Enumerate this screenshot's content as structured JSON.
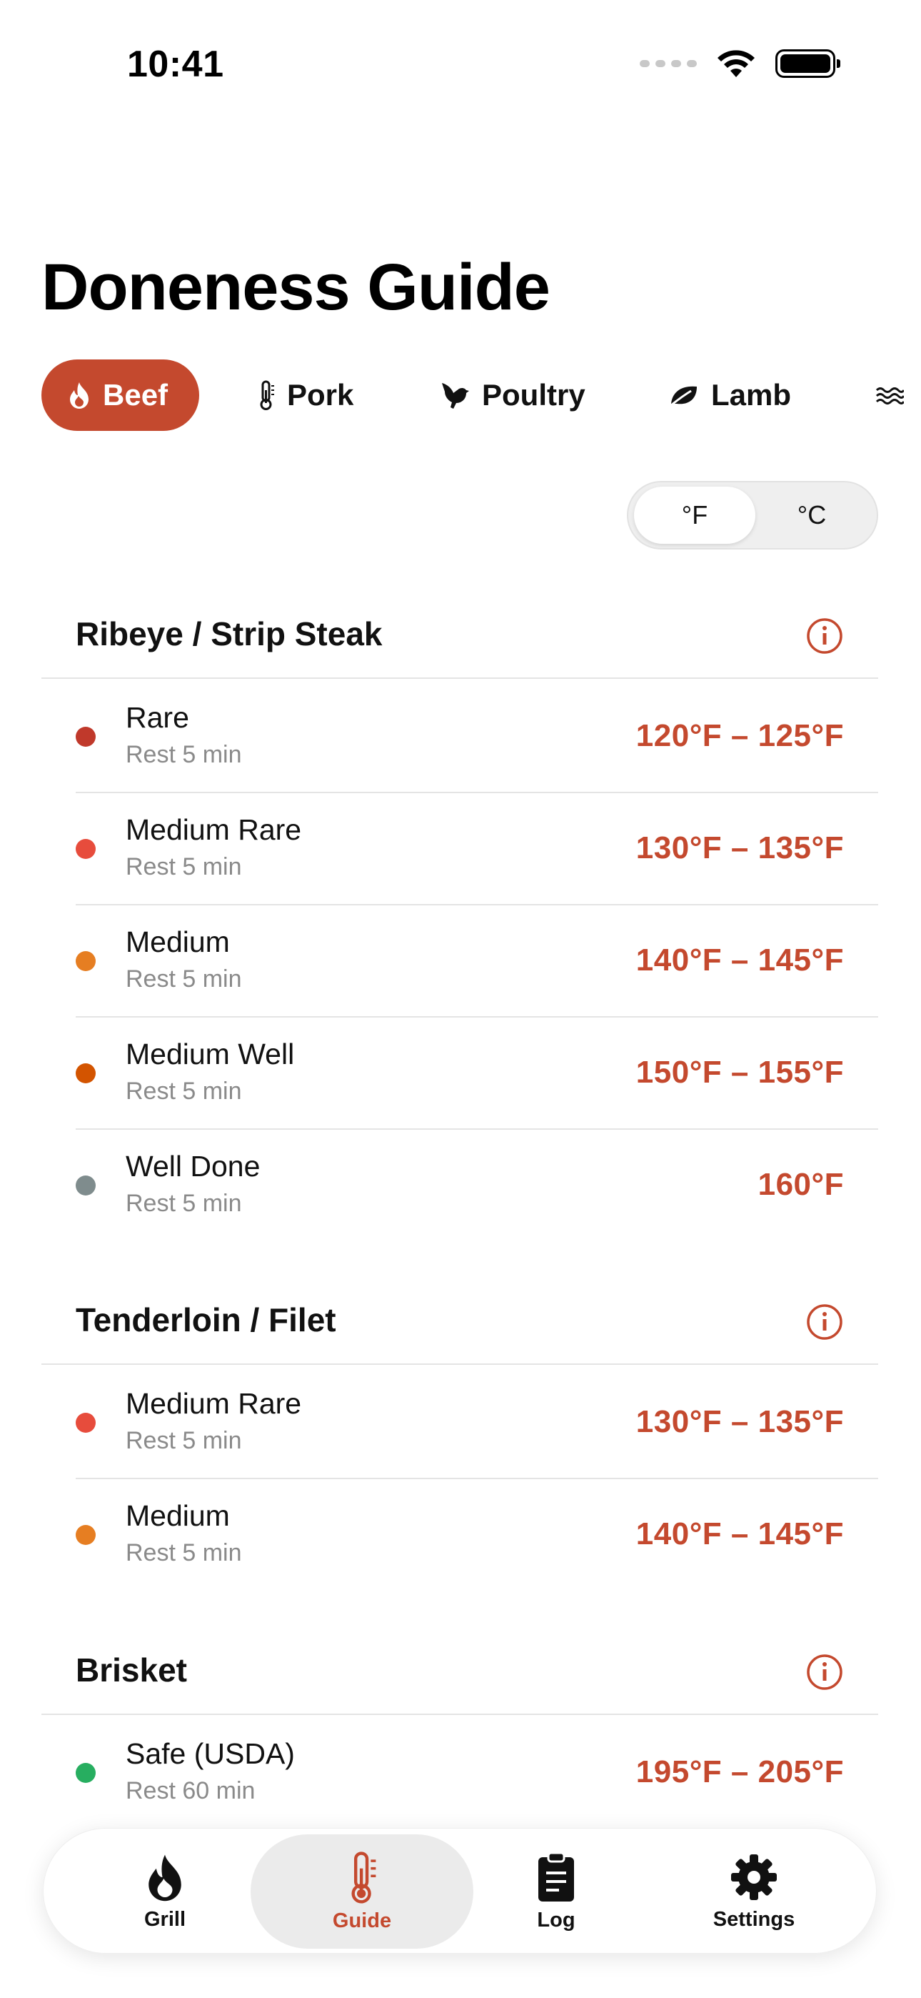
{
  "status_bar": {
    "time": "10:41"
  },
  "page": {
    "title": "Doneness Guide"
  },
  "categories": [
    {
      "label": "Beef",
      "icon": "flame-icon",
      "active": true
    },
    {
      "label": "Pork",
      "icon": "thermometer-icon",
      "active": false
    },
    {
      "label": "Poultry",
      "icon": "bird-icon",
      "active": false
    },
    {
      "label": "Lamb",
      "icon": "leaf-icon",
      "active": false
    },
    {
      "label": "",
      "icon": "waves-icon",
      "active": false
    }
  ],
  "units": {
    "fahrenheit": "°F",
    "celsius": "°C",
    "selected": "°F"
  },
  "sections": [
    {
      "title": "Ribeye / Strip Steak",
      "rows": [
        {
          "name": "Rare",
          "rest": "Rest 5 min",
          "temp": "120°F – 125°F",
          "color": "#c0392b"
        },
        {
          "name": "Medium Rare",
          "rest": "Rest 5 min",
          "temp": "130°F – 135°F",
          "color": "#e74c3c"
        },
        {
          "name": "Medium",
          "rest": "Rest 5 min",
          "temp": "140°F – 145°F",
          "color": "#e67e22"
        },
        {
          "name": "Medium Well",
          "rest": "Rest 5 min",
          "temp": "150°F – 155°F",
          "color": "#d35400"
        },
        {
          "name": "Well Done",
          "rest": "Rest 5 min",
          "temp": "160°F",
          "color": "#7f8c8d"
        }
      ]
    },
    {
      "title": "Tenderloin / Filet",
      "rows": [
        {
          "name": "Medium Rare",
          "rest": "Rest 5 min",
          "temp": "130°F – 135°F",
          "color": "#e74c3c"
        },
        {
          "name": "Medium",
          "rest": "Rest 5 min",
          "temp": "140°F – 145°F",
          "color": "#e67e22"
        }
      ]
    },
    {
      "title": "Brisket",
      "rows": [
        {
          "name": "Safe (USDA)",
          "rest": "Rest 60 min",
          "temp": "195°F – 205°F",
          "color": "#27ae60"
        }
      ]
    }
  ],
  "tab_bar": [
    {
      "label": "Grill",
      "icon": "flame-icon",
      "active": false
    },
    {
      "label": "Guide",
      "icon": "thermometer-icon",
      "active": true
    },
    {
      "label": "Log",
      "icon": "clipboard-icon",
      "active": false
    },
    {
      "label": "Settings",
      "icon": "gear-icon",
      "active": false
    }
  ],
  "colors": {
    "accent": "#c4492e"
  }
}
